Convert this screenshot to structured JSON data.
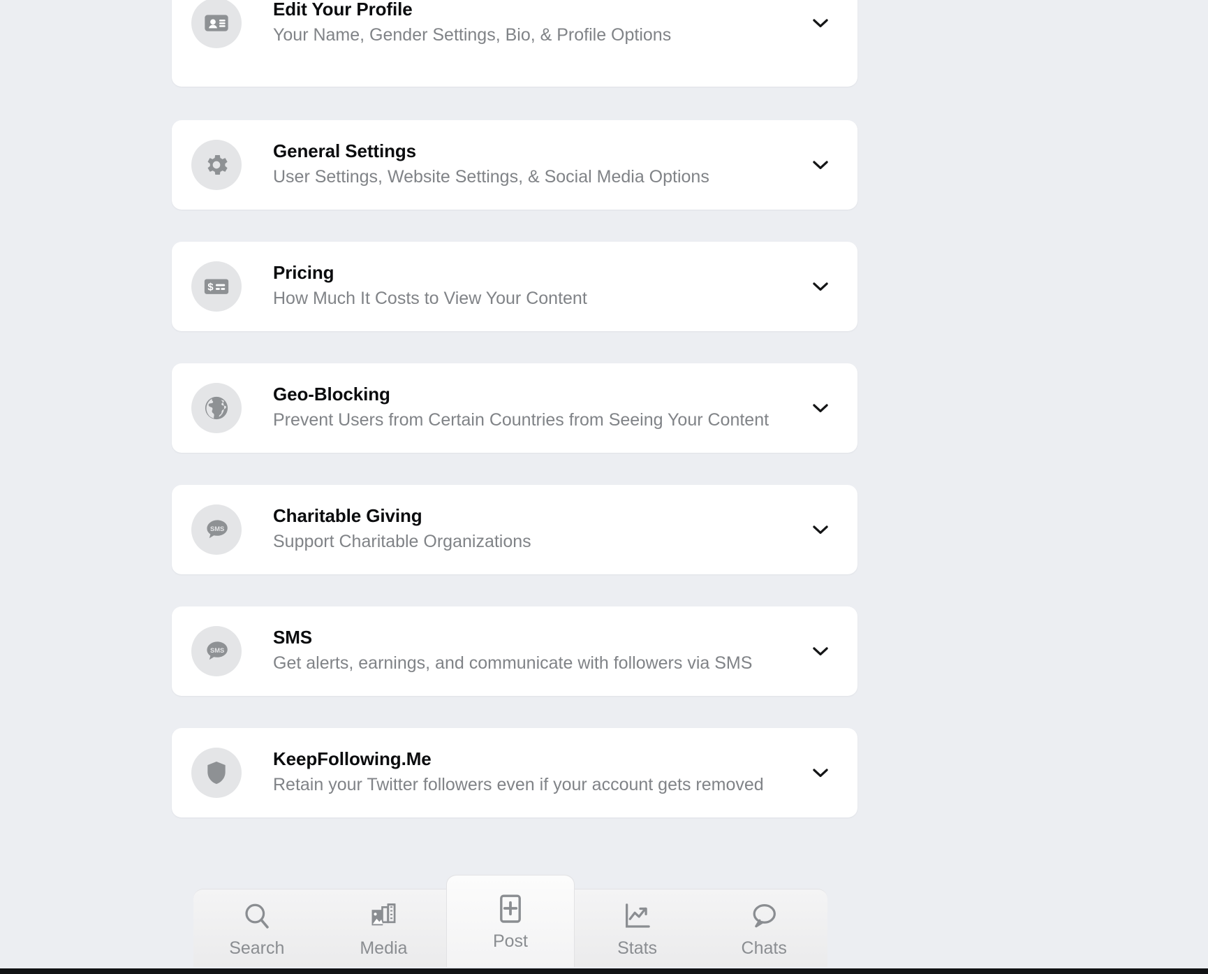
{
  "background_color": "#eceef2",
  "card_color": "#ffffff",
  "title_color": "#0b0c0e",
  "subtitle_color": "#808387",
  "icon_circle_color": "#e4e5e7",
  "icon_glyph_color": "#8e9194",
  "settings": {
    "items": [
      {
        "icon": "id-card-icon",
        "title": "Edit Your Profile",
        "subtitle": "Your Name, Gender Settings, Bio, & Profile Options",
        "chevron": "chevron-down-icon"
      },
      {
        "icon": "gear-icon",
        "title": "General Settings",
        "subtitle": "User Settings, Website Settings, & Social Media Options",
        "chevron": "chevron-down-icon"
      },
      {
        "icon": "payment-card-icon",
        "title": "Pricing",
        "subtitle": "How Much It Costs to View Your Content",
        "chevron": "chevron-down-icon"
      },
      {
        "icon": "globe-icon",
        "title": "Geo-Blocking",
        "subtitle": "Prevent Users from Certain Countries from Seeing Your Content",
        "chevron": "chevron-down-icon"
      },
      {
        "icon": "sms-bubble-icon",
        "title": "Charitable Giving",
        "subtitle": "Support Charitable Organizations",
        "chevron": "chevron-down-icon"
      },
      {
        "icon": "sms-bubble-icon",
        "title": "SMS",
        "subtitle": "Get alerts, earnings, and communicate with followers via SMS",
        "chevron": "chevron-down-icon"
      },
      {
        "icon": "shield-icon",
        "title": "KeepFollowing.Me",
        "subtitle": "Retain your Twitter followers even if your account gets removed",
        "chevron": "chevron-down-icon"
      }
    ]
  },
  "tab_bar": {
    "tabs": [
      {
        "label": "Search",
        "icon": "search-icon",
        "active": false
      },
      {
        "label": "Media",
        "icon": "media-icon",
        "active": false
      },
      {
        "label": "Post",
        "icon": "post-plus-icon",
        "active": true
      },
      {
        "label": "Stats",
        "icon": "stats-icon",
        "active": false
      },
      {
        "label": "Chats",
        "icon": "chat-bubble-icon",
        "active": false
      }
    ]
  }
}
